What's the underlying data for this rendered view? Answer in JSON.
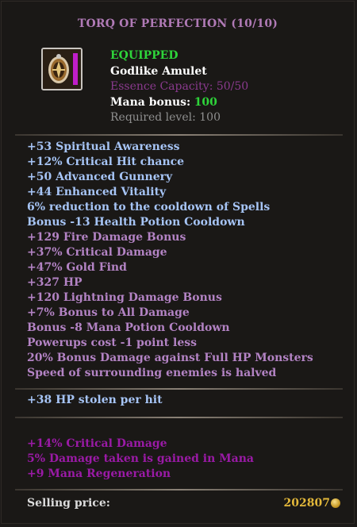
{
  "item": {
    "title": "TORQ OF PERFECTION (10/10)",
    "equipped_label": "EQUIPPED",
    "type": "Godlike Amulet",
    "essence_capacity": "Essence Capacity: 50/50",
    "mana_bonus_label": "Mana bonus:",
    "mana_bonus_value": "100",
    "required_level": "Required level: 100",
    "icon": "amulet-icon"
  },
  "stats": [
    {
      "text": "+53 Spiritual Awareness",
      "color": "#a6c4f5"
    },
    {
      "text": "+12% Critical Hit chance",
      "color": "#a6c4f5"
    },
    {
      "text": "+50 Advanced Gunnery",
      "color": "#a6c4f5"
    },
    {
      "text": "+44 Enhanced Vitality",
      "color": "#a6c4f5"
    },
    {
      "text": "6% reduction to the cooldown of Spells",
      "color": "#a6c4f5"
    },
    {
      "text": "Bonus -13 Health Potion Cooldown",
      "color": "#a6c4f5"
    },
    {
      "text": "+129 Fire Damage Bonus",
      "color": "#b383c4"
    },
    {
      "text": "+37% Critical Damage",
      "color": "#b383c4"
    },
    {
      "text": "+47% Gold Find",
      "color": "#b383c4"
    },
    {
      "text": "+327 HP",
      "color": "#b383c4"
    },
    {
      "text": "+120 Lightning Damage Bonus",
      "color": "#b383c4"
    },
    {
      "text": "+7% Bonus to All Damage",
      "color": "#b383c4"
    },
    {
      "text": "Bonus -8 Mana Potion Cooldown",
      "color": "#b383c4"
    },
    {
      "text": "Powerups cost -1 point less",
      "color": "#b383c4"
    },
    {
      "text": "20% Bonus Damage against Full HP Monsters",
      "color": "#b383c4"
    },
    {
      "text": "Speed of surrounding enemies is halved",
      "color": "#b383c4"
    }
  ],
  "hp_stolen": "+38 HP stolen per hit",
  "essence_bonuses": [
    "+14% Critical Damage",
    "5% Damage taken is gained in Mana",
    "+9 Mana Regeneration"
  ],
  "price": {
    "label": "Selling price:",
    "value": "202807",
    "icon": "gold-coin-icon"
  },
  "colors": {
    "title": "#b07ab6",
    "equipped": "#2ed43a",
    "blue_stat": "#a6c4f5",
    "purple_stat": "#b383c4",
    "essence_bonus": "#9a1aa6",
    "gold": "#e3b83a"
  }
}
